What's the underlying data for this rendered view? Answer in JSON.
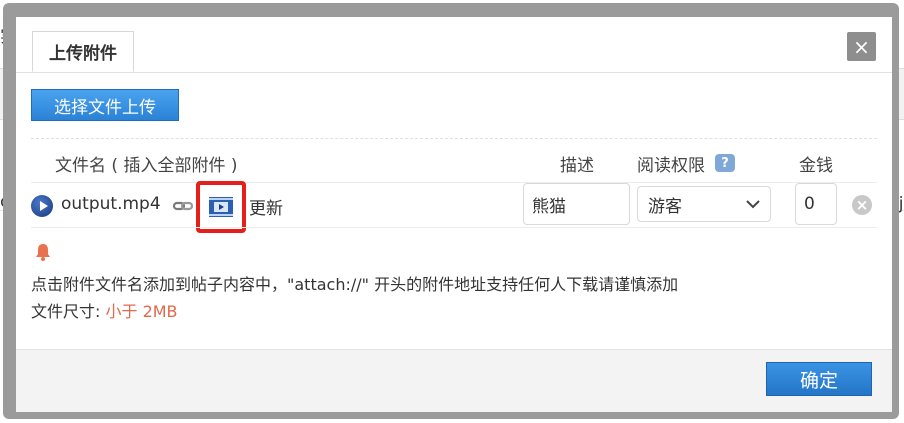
{
  "background": {
    "frag_top_left": "实",
    "frag_left_row": "cc",
    "frag_right_row": "Nj"
  },
  "dialog": {
    "tab_label": "上传附件",
    "close_glyph": "×",
    "upload_button": "选择文件上传",
    "columns": {
      "filename": "文件名",
      "insert_all": "( 插入全部附件 )",
      "desc": "描述",
      "perm": "阅读权限",
      "help_glyph": "?",
      "money": "金钱"
    },
    "file": {
      "name": "output.mp4",
      "update_label": "更新",
      "desc_value": "熊猫",
      "perm_value": "游客",
      "money_value": "0",
      "remove_glyph": "×"
    },
    "tip": "点击附件文件名添加到帖子内容中，\"attach://\" 开头的附件地址支持任何人下载请谨慎添加",
    "size_label": "文件尺寸: ",
    "size_value": "小于 2MB",
    "confirm_button": "确定"
  },
  "colors": {
    "accent_blue": "#2d84d8",
    "highlight_red": "#e5201b",
    "size_orange": "#e06a4a"
  }
}
